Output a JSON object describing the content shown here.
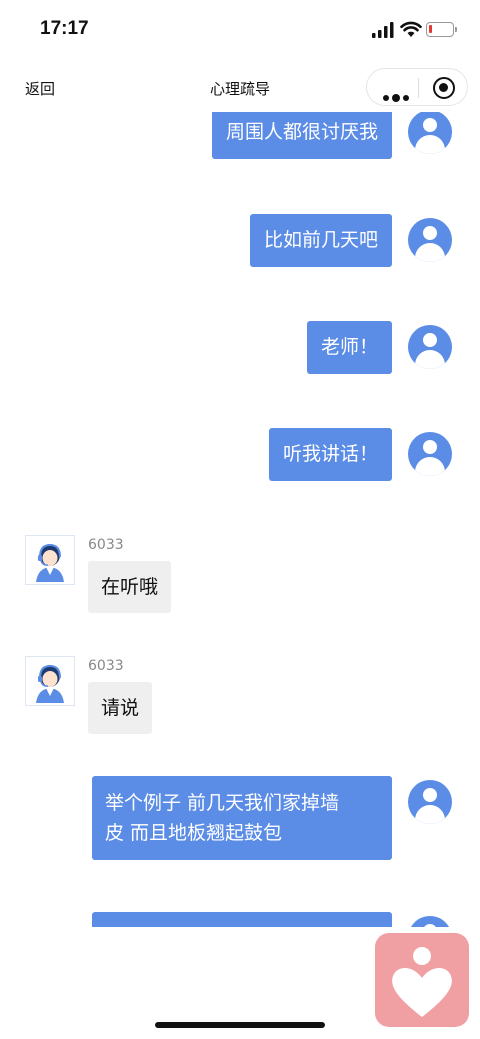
{
  "status_bar": {
    "time": "17:17"
  },
  "nav": {
    "back_label": "返回",
    "title": "心理疏导"
  },
  "messages": {
    "m1": "周围人都很讨厌我",
    "m2": "比如前几天吧",
    "m3": "老师！",
    "m4": "听我讲话！",
    "a1": {
      "name": "6033",
      "text": "在听哦"
    },
    "a2": {
      "name": "6033",
      "text": "请说"
    },
    "m5_line1": "举个例子 前几天我们家掉墙",
    "m5_line2": "皮 而且地板翘起鼓包"
  },
  "colors": {
    "user_bubble": "#5b8ce6",
    "agent_bubble": "#efefef",
    "float_button": "#f0a0a3"
  },
  "icons": {
    "user_avatar": "user-icon",
    "agent_avatar": "agent-headset-icon",
    "float_button": "heart-person-icon"
  }
}
